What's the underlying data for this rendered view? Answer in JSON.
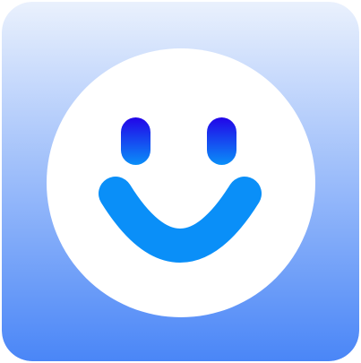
{
  "icon": {
    "name": "smiley-face-app-icon",
    "colors": {
      "background_top": "#eaf1fd",
      "background_bottom": "#4a86f7",
      "face_fill": "#ffffff",
      "feature_top": "#2204e8",
      "feature_bottom": "#0a8ff8"
    }
  }
}
